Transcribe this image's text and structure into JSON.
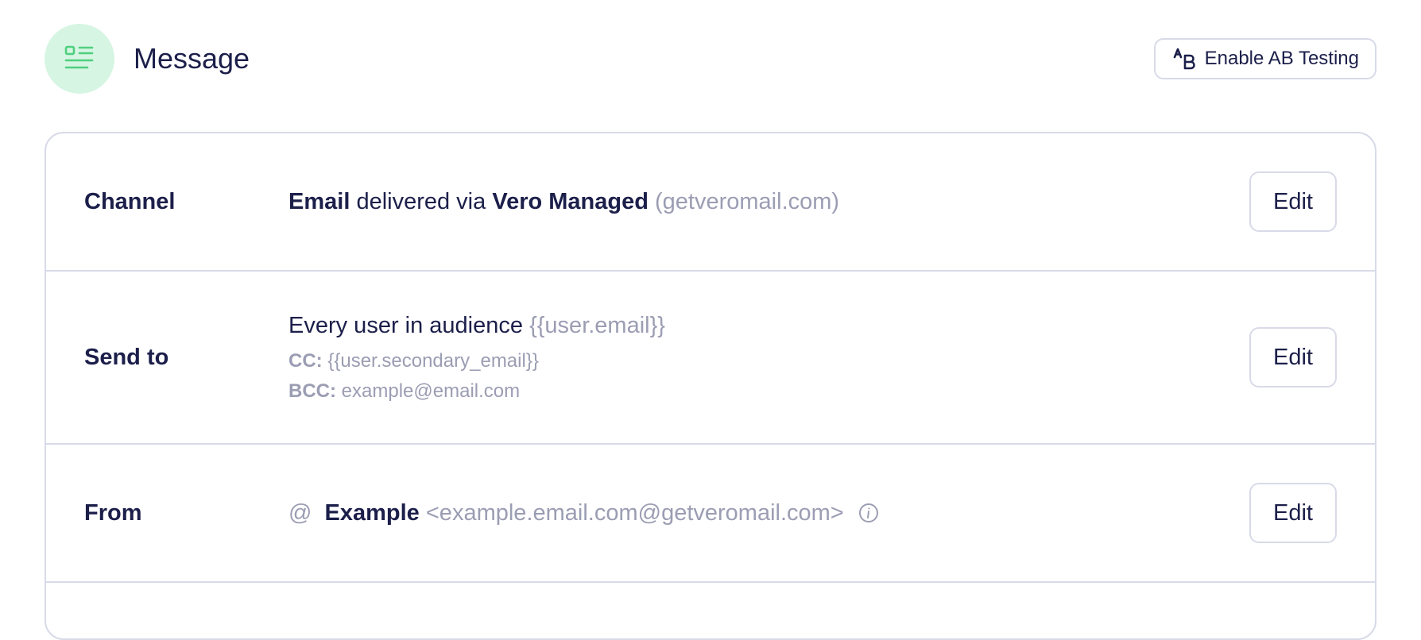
{
  "header": {
    "title": "Message",
    "ab_button_label": "Enable AB Testing",
    "icon": "message-list-icon",
    "icon_color": "#4fcf7f",
    "icon_bg": "#d6f5e3"
  },
  "rows": {
    "channel": {
      "label": "Channel",
      "channel_type": "Email",
      "connector": "delivered via",
      "provider": "Vero Managed",
      "domain": "(getveromail.com)",
      "edit_label": "Edit"
    },
    "send_to": {
      "label": "Send to",
      "audience": "Every user in audience",
      "recipient_var": "{{user.email}}",
      "cc_key": "CC:",
      "cc_value": "{{user.secondary_email}}",
      "bcc_key": "BCC:",
      "bcc_value": "example@email.com",
      "edit_label": "Edit"
    },
    "from": {
      "label": "From",
      "at_symbol": "@",
      "sender_name": "Example",
      "sender_address": "<example.email.com@getveromail.com>",
      "info_icon": "info-icon",
      "edit_label": "Edit"
    }
  },
  "colors": {
    "text_primary": "#1c1f4a",
    "text_muted": "#9b9db3",
    "border": "#d8dae8"
  }
}
